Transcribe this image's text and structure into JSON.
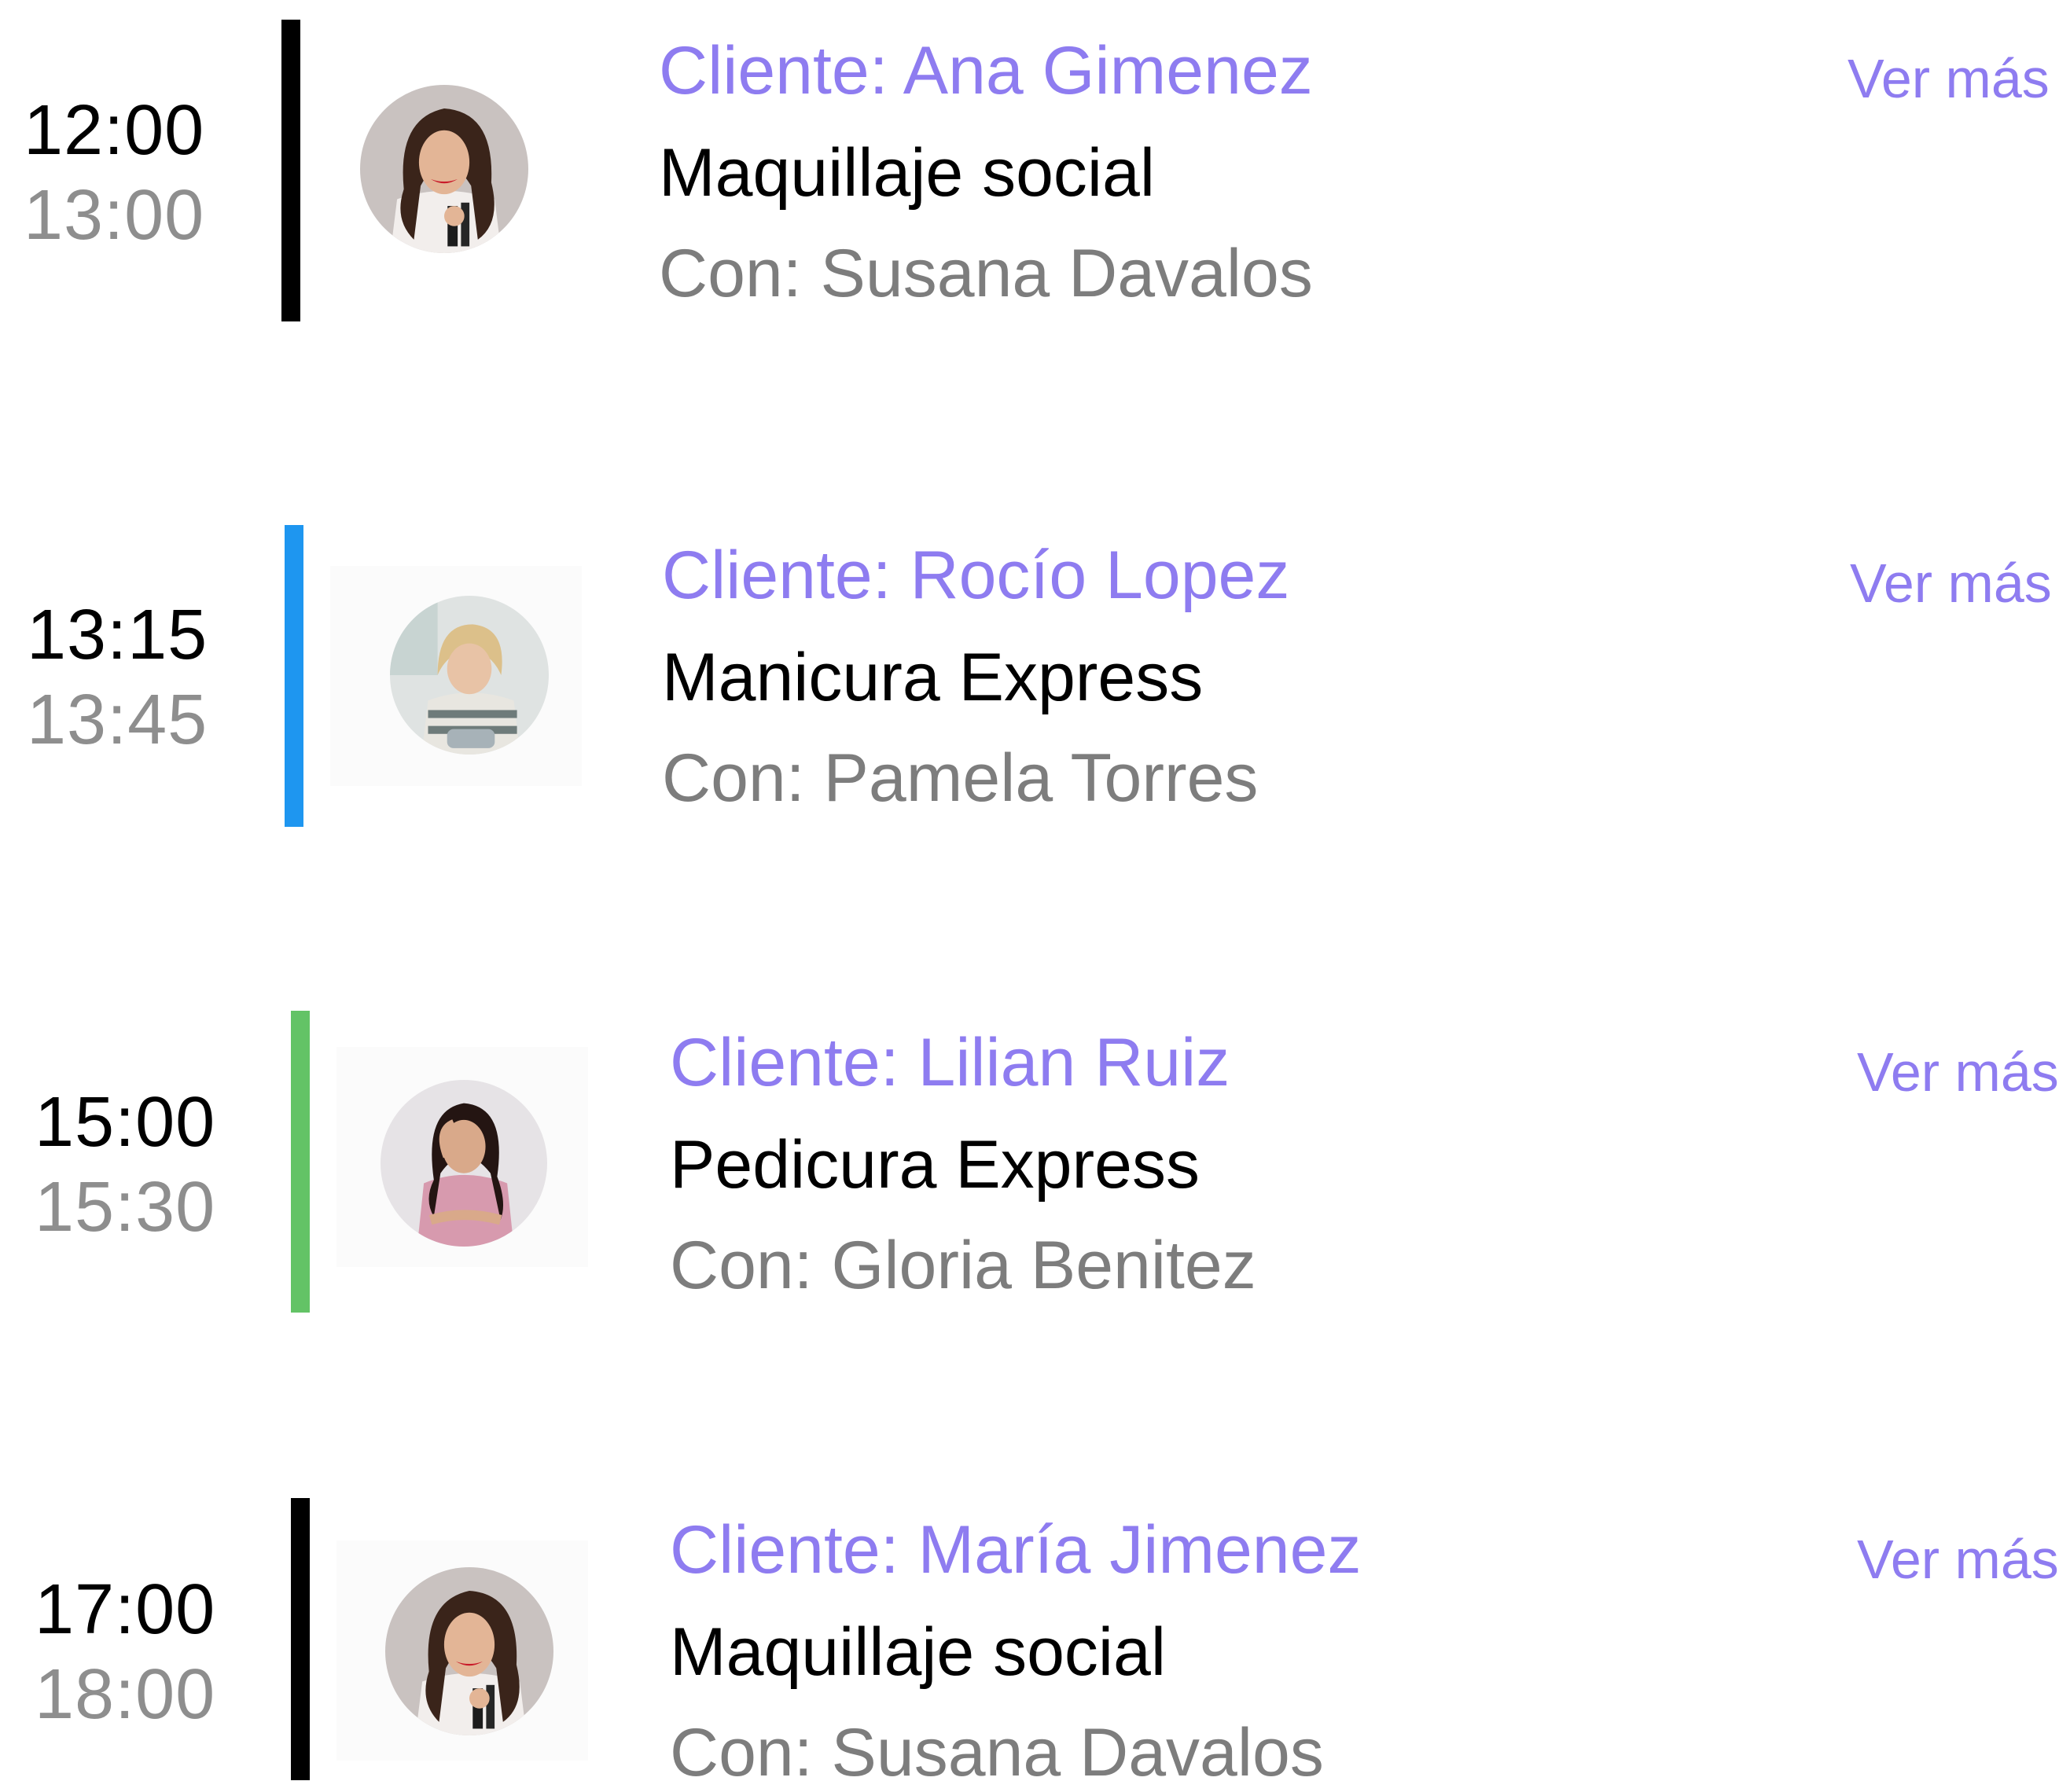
{
  "colors": {
    "accent": "#8e7cf0",
    "secondary_text": "#7d7d7d",
    "end_time": "#8e8e8e"
  },
  "appointments": [
    {
      "start": "12:00",
      "end": "13:00",
      "client": "Cliente: Ana Gimenez",
      "service": "Maquillaje social",
      "staff": "Con: Susana Davalos",
      "more": "Ver más",
      "bar_color": "#000000",
      "avatar_icon": "makeup-artist-photo"
    },
    {
      "start": "13:15",
      "end": "13:45",
      "client": "Cliente: Rocío Lopez",
      "service": "Manicura Express",
      "staff": "Con: Pamela Torres",
      "more": "Ver más",
      "bar_color": "#1e96f0",
      "avatar_icon": "manicurist-photo"
    },
    {
      "start": "15:00",
      "end": "15:30",
      "client": "Cliente: Lilian Ruiz",
      "service": "Pedicura Express",
      "staff": "Con: Gloria Benitez",
      "more": "Ver más",
      "bar_color": "#63c366",
      "avatar_icon": "pedicurist-photo"
    },
    {
      "start": "17:00",
      "end": "18:00",
      "client": "Cliente: María Jimenez",
      "service": "Maquillaje social",
      "staff": "Con: Susana Davalos",
      "more": "Ver más",
      "bar_color": "#000000",
      "avatar_icon": "makeup-artist-photo"
    }
  ]
}
